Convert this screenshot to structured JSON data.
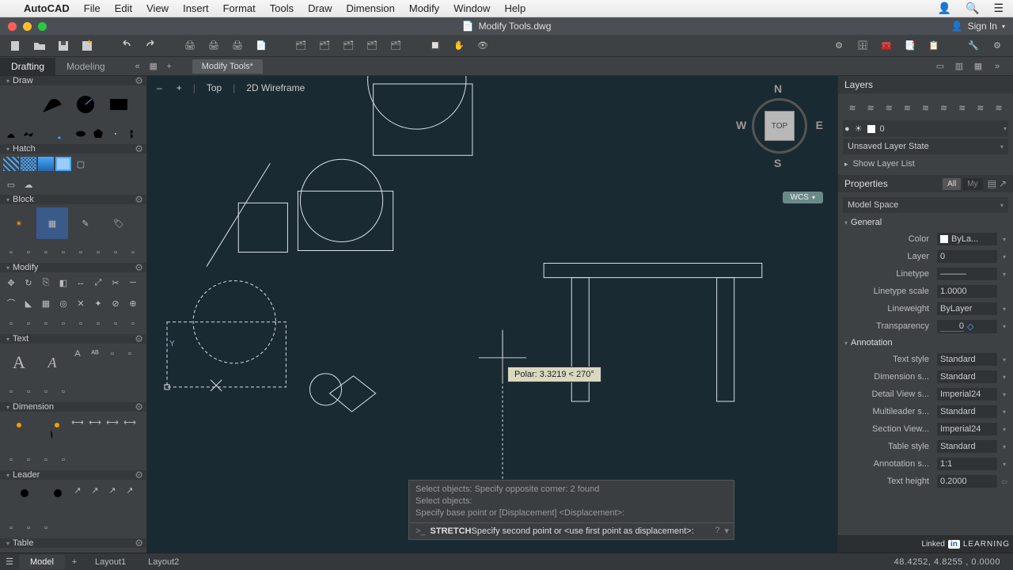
{
  "menubar": {
    "apple": "",
    "app": "AutoCAD",
    "items": [
      "File",
      "Edit",
      "View",
      "Insert",
      "Format",
      "Tools",
      "Draw",
      "Dimension",
      "Modify",
      "Window",
      "Help"
    ]
  },
  "titlerow": {
    "doc_icon": "▤",
    "title": "Modify Tools.dwg",
    "signin": "Sign In"
  },
  "workspace": {
    "tabs": [
      "Drafting",
      "Modeling"
    ],
    "active": 0,
    "doc_tab": "Modify Tools*"
  },
  "view": {
    "controls": [
      "–",
      "+"
    ],
    "labels": [
      "Top",
      "2D Wireframe"
    ],
    "cube_face": "TOP",
    "dirs": {
      "n": "N",
      "s": "S",
      "e": "E",
      "w": "W"
    },
    "wcs": "WCS"
  },
  "palette": {
    "sections": {
      "draw": "Draw",
      "hatch": "Hatch",
      "block": "Block",
      "modify": "Modify",
      "text": "Text",
      "dimension": "Dimension",
      "leader": "Leader",
      "table": "Table"
    }
  },
  "tooltip": {
    "polar": "Polar: 3.3219 < 270°"
  },
  "command": {
    "history": [
      "Select objects: Specify opposite corner: 2 found",
      "Select objects:",
      "Specify base point or [Displacement] <Displacement>:"
    ],
    "prompt": ">_",
    "line_cmd": "STRETCH",
    "line_tail": " Specify second point or <use first point as displacement>:"
  },
  "right": {
    "layers_title": "Layers",
    "layer_name": "0",
    "unsaved_state": "Unsaved Layer State",
    "show_list": "Show Layer List",
    "props_title": "Properties",
    "props_tabs": {
      "all": "All",
      "my": "My"
    },
    "space": "Model Space",
    "groups": {
      "general": "General",
      "annotation": "Annotation"
    },
    "rows": {
      "color": {
        "lbl": "Color",
        "val": "ByLa..."
      },
      "layer": {
        "lbl": "Layer",
        "val": "0"
      },
      "linetype": {
        "lbl": "Linetype",
        "val": "—"
      },
      "linetypescale": {
        "lbl": "Linetype scale",
        "val": "1.0000"
      },
      "lineweight": {
        "lbl": "Lineweight",
        "val": "ByLayer"
      },
      "transparency": {
        "lbl": "Transparency",
        "val": "0",
        "icon": "◇"
      },
      "textstyle": {
        "lbl": "Text style",
        "val": "Standard"
      },
      "dimstyle": {
        "lbl": "Dimension s...",
        "val": "Standard"
      },
      "detailview": {
        "lbl": "Detail View s...",
        "val": "Imperial24"
      },
      "multileader": {
        "lbl": "Multileader s...",
        "val": "Standard"
      },
      "sectionview": {
        "lbl": "Section View...",
        "val": "Imperial24"
      },
      "tablestyle": {
        "lbl": "Table style",
        "val": "Standard"
      },
      "annoscale": {
        "lbl": "Annotation s...",
        "val": "1:1"
      },
      "textheight": {
        "lbl": "Text height",
        "val": "0.2000"
      }
    }
  },
  "status": {
    "tabs": [
      "Model",
      "Layout1",
      "Layout2"
    ],
    "active": 0,
    "coords": "48.4252, 4.8255 , 0.0000"
  },
  "branding": {
    "linkedin": "Linked",
    "learning": "LEARNING"
  }
}
